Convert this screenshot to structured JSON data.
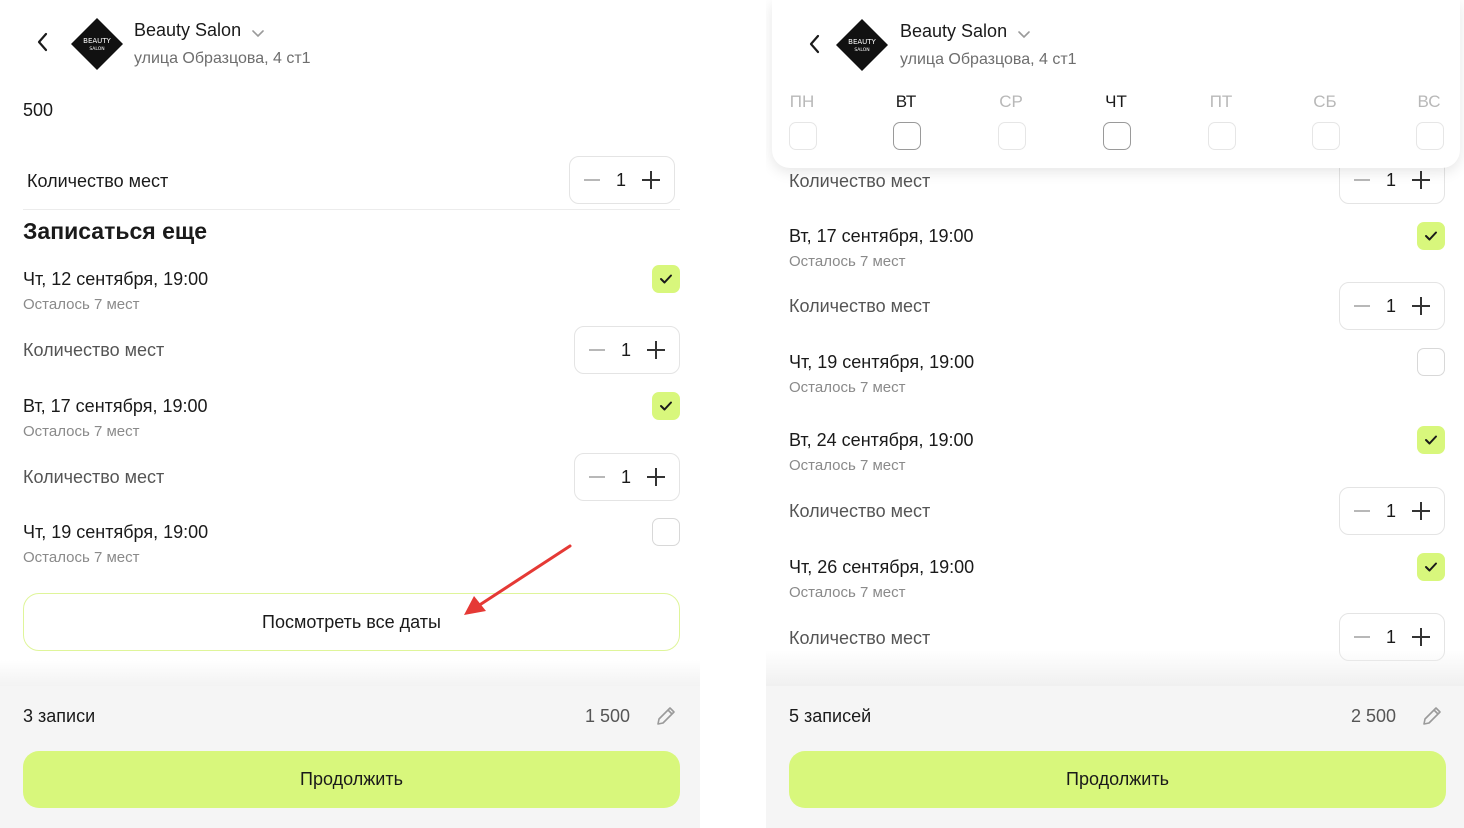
{
  "header": {
    "salon_name": "Beauty Salon",
    "address": "улица Образцова, 4 ст1",
    "logo_text_top": "BEAUTY",
    "logo_text_bottom": "SALON"
  },
  "left": {
    "price_top": "500",
    "first_qty_label": "Количество мест",
    "first_qty_value": "1",
    "section_title": "Записаться еще",
    "sessions": [
      {
        "date": "Чт, 12 сентября, 19:00",
        "seats_left": "Осталось 7 мест",
        "checked": true,
        "qty_label": "Количество мест",
        "qty": "1"
      },
      {
        "date": "Вт, 17 сентября, 19:00",
        "seats_left": "Осталось 7 мест",
        "checked": true,
        "qty_label": "Количество мест",
        "qty": "1"
      },
      {
        "date": "Чт, 19 сентября, 19:00",
        "seats_left": "Осталось 7 мест",
        "checked": false
      }
    ],
    "all_dates_button": "Посмотреть все даты",
    "footer": {
      "count": "3 записи",
      "total": "1 500",
      "continue": "Продолжить"
    }
  },
  "right": {
    "weekdays": [
      {
        "label": "ПН",
        "active": false
      },
      {
        "label": "ВТ",
        "active": true
      },
      {
        "label": "СР",
        "active": false
      },
      {
        "label": "ЧТ",
        "active": true
      },
      {
        "label": "ПТ",
        "active": false
      },
      {
        "label": "СБ",
        "active": false
      },
      {
        "label": "ВС",
        "active": false
      }
    ],
    "top_qty_label": "Количество мест",
    "top_qty_value": "1",
    "sessions": [
      {
        "date": "Вт, 17 сентября, 19:00",
        "seats_left": "Осталось 7 мест",
        "checked": true,
        "qty_label": "Количество мест",
        "qty": "1"
      },
      {
        "date": "Чт, 19 сентября, 19:00",
        "seats_left": "Осталось 7 мест",
        "checked": false
      },
      {
        "date": "Вт, 24 сентября, 19:00",
        "seats_left": "Осталось 7 мест",
        "checked": true,
        "qty_label": "Количество мест",
        "qty": "1"
      },
      {
        "date": "Чт, 26 сентября, 19:00",
        "seats_left": "Осталось 7 мест",
        "checked": true,
        "qty_label": "Количество мест",
        "qty": "1"
      }
    ],
    "footer": {
      "count": "5 записей",
      "total": "2 500",
      "continue": "Продолжить"
    }
  },
  "colors": {
    "accent": "#d8f77c",
    "arrow": "#e53935"
  }
}
